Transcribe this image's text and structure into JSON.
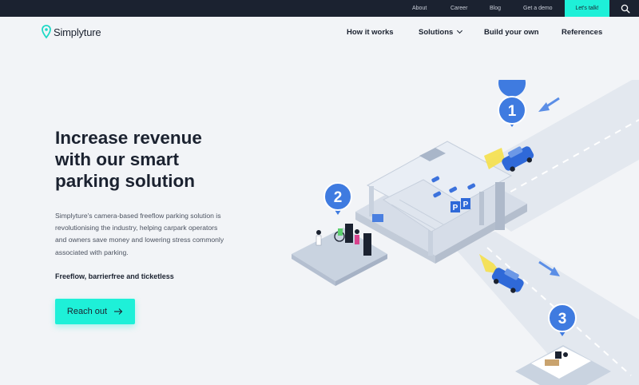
{
  "topbar": {
    "links": [
      "About",
      "Career",
      "Blog",
      "Get a demo"
    ],
    "cta_label": "Let's talk!",
    "search_icon": "search-icon"
  },
  "header": {
    "logo_text": "Simplyture",
    "logo_icon": "location-pin-icon",
    "nav": [
      "How it works",
      "Solutions",
      "Build your own",
      "References"
    ]
  },
  "hero": {
    "title_line1": "Increase revenue",
    "title_line2": "with our smart",
    "title_line3": "parking solution",
    "desc_line1": "Simplyture's camera-based freeflow parking solution is",
    "desc_line2": "revolutionising the industry, helping carpark operators",
    "desc_line3": "and owners save money and lowering stress commonly",
    "desc_line4": "associated with parking.",
    "tagline": "Freeflow, barrierfree and ticketless",
    "button_label": "Reach out",
    "button_icon": "arrow-right-icon"
  },
  "illustration": {
    "markers": [
      "1",
      "2",
      "3"
    ],
    "parking_signs": [
      "P",
      "P"
    ]
  },
  "colors": {
    "accent": "#1ef0d8",
    "dark": "#1b2230",
    "marker_blue": "#3f7be0",
    "car_blue": "#2f69d8"
  }
}
